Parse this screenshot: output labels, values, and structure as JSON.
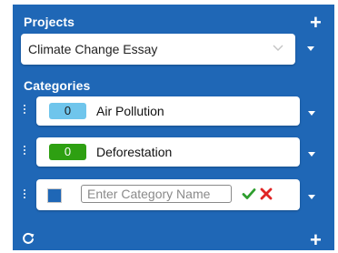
{
  "projects": {
    "title": "Projects",
    "selected": "Climate Change Essay"
  },
  "categories": {
    "title": "Categories",
    "items": [
      {
        "count": "0",
        "label": "Air Pollution",
        "badge_color": "#6fc5ec"
      },
      {
        "count": "0",
        "label": "Deforestation",
        "badge_color": "#2ea012"
      }
    ],
    "new_item": {
      "placeholder": "Enter Category Name",
      "value": ""
    }
  },
  "colors": {
    "panel": "#1f67b6",
    "confirm": "#2e9e2e",
    "cancel": "#e02424"
  },
  "icons": {
    "add_project": "plus-icon",
    "add_category": "plus-icon",
    "refresh": "refresh-icon",
    "drag": "drag-handle-icon",
    "confirm": "check-icon",
    "cancel": "close-icon"
  }
}
